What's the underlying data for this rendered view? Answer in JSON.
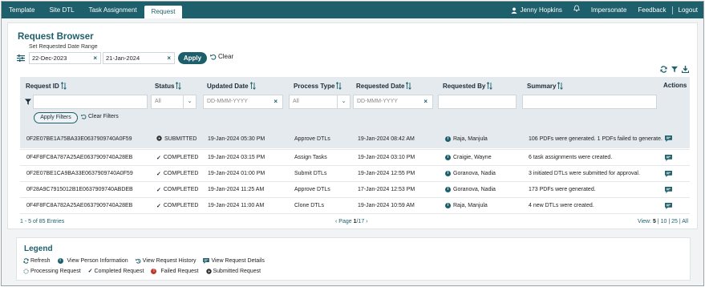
{
  "nav": {
    "left": [
      "Template",
      "Site DTL",
      "Task Assignment",
      "Request"
    ],
    "active": "Request",
    "user": "Jenny Hopkins",
    "impersonate": "Impersonate",
    "feedback": "Feedback",
    "logout": "Logout"
  },
  "page": {
    "title": "Request Browser",
    "date_range_label": "Set Requested Date Range",
    "date_from": "22-Dec-2023",
    "date_to": "21-Jan-2024",
    "apply": "Apply",
    "clear": "Clear"
  },
  "grid": {
    "columns": [
      "Request ID",
      "Status",
      "Updated Date",
      "Process Type",
      "Requested Date",
      "Requested By",
      "Summary",
      "Actions"
    ],
    "filters": {
      "status": "All",
      "updated_date": "DD-MMM-YYYY",
      "process_type": "All",
      "requested_date": "DD-MMM-YYYY"
    },
    "apply_filters": "Apply Filters",
    "clear_filters": "Clear Filters",
    "rows": [
      {
        "id": "0F2E07BE1A75BA33E0637909740A0F59",
        "status": "SUBMITTED",
        "status_icon": "submitted-icon",
        "updated": "19-Jan-2024 05:30 PM",
        "process": "Approve DTLs",
        "requested": "19-Jan-2024 08:42 AM",
        "by": "Raja, Manjula",
        "summary": "106 PDFs were generated. 1 PDFs failed to generate."
      },
      {
        "id": "0F4F8FC8A787A25AE0637909740A28EB",
        "status": "COMPLETED",
        "status_icon": "check-icon",
        "updated": "19-Jan-2024 03:15 PM",
        "process": "Assign Tasks",
        "requested": "19-Jan-2024 03:10 PM",
        "by": "Craigie, Wayne",
        "summary": "6 task assignments were created."
      },
      {
        "id": "0F2E07BE1CA9BA33E0637909740A0F59",
        "status": "COMPLETED",
        "status_icon": "check-icon",
        "updated": "19-Jan-2024 01:00 PM",
        "process": "Submit DTLs",
        "requested": "19-Jan-2024 12:55 PM",
        "by": "Goranova, Nadia",
        "summary": "3 initiated DTLs were submitted for approval."
      },
      {
        "id": "0F28A9C7915012B1E0637909740ABDEB",
        "status": "COMPLETED",
        "status_icon": "check-icon",
        "updated": "19-Jan-2024 11:25 AM",
        "process": "Approve DTLs",
        "requested": "17-Jan-2024 12:53 PM",
        "by": "Goranova, Nadia",
        "summary": "173 PDFs were generated."
      },
      {
        "id": "0F4F8FC8A782A25AE0637909740A28EB",
        "status": "COMPLETED",
        "status_icon": "check-icon",
        "updated": "19-Jan-2024 11:00 AM",
        "process": "Clone DTLs",
        "requested": "19-Jan-2024 10:59 AM",
        "by": "Raja, Manjula",
        "summary": "4 new DTLs were created."
      }
    ],
    "entries": "1 - 5 of 85 Entries",
    "page_prefix": "Page ",
    "page_current": "1",
    "page_total": "/17",
    "view_label": "View:",
    "view_options": [
      "5",
      "10",
      "25",
      "All"
    ]
  },
  "legend": {
    "title": "Legend",
    "row1": [
      "Refresh",
      "View Person Information",
      "View Request History",
      "View Request Details"
    ],
    "row2": [
      "Processing Request",
      "Completed Request",
      "Failed Request",
      "Submitted Request"
    ]
  },
  "colors": {
    "primary": "#1d5f6b",
    "failed": "#c0392b"
  }
}
